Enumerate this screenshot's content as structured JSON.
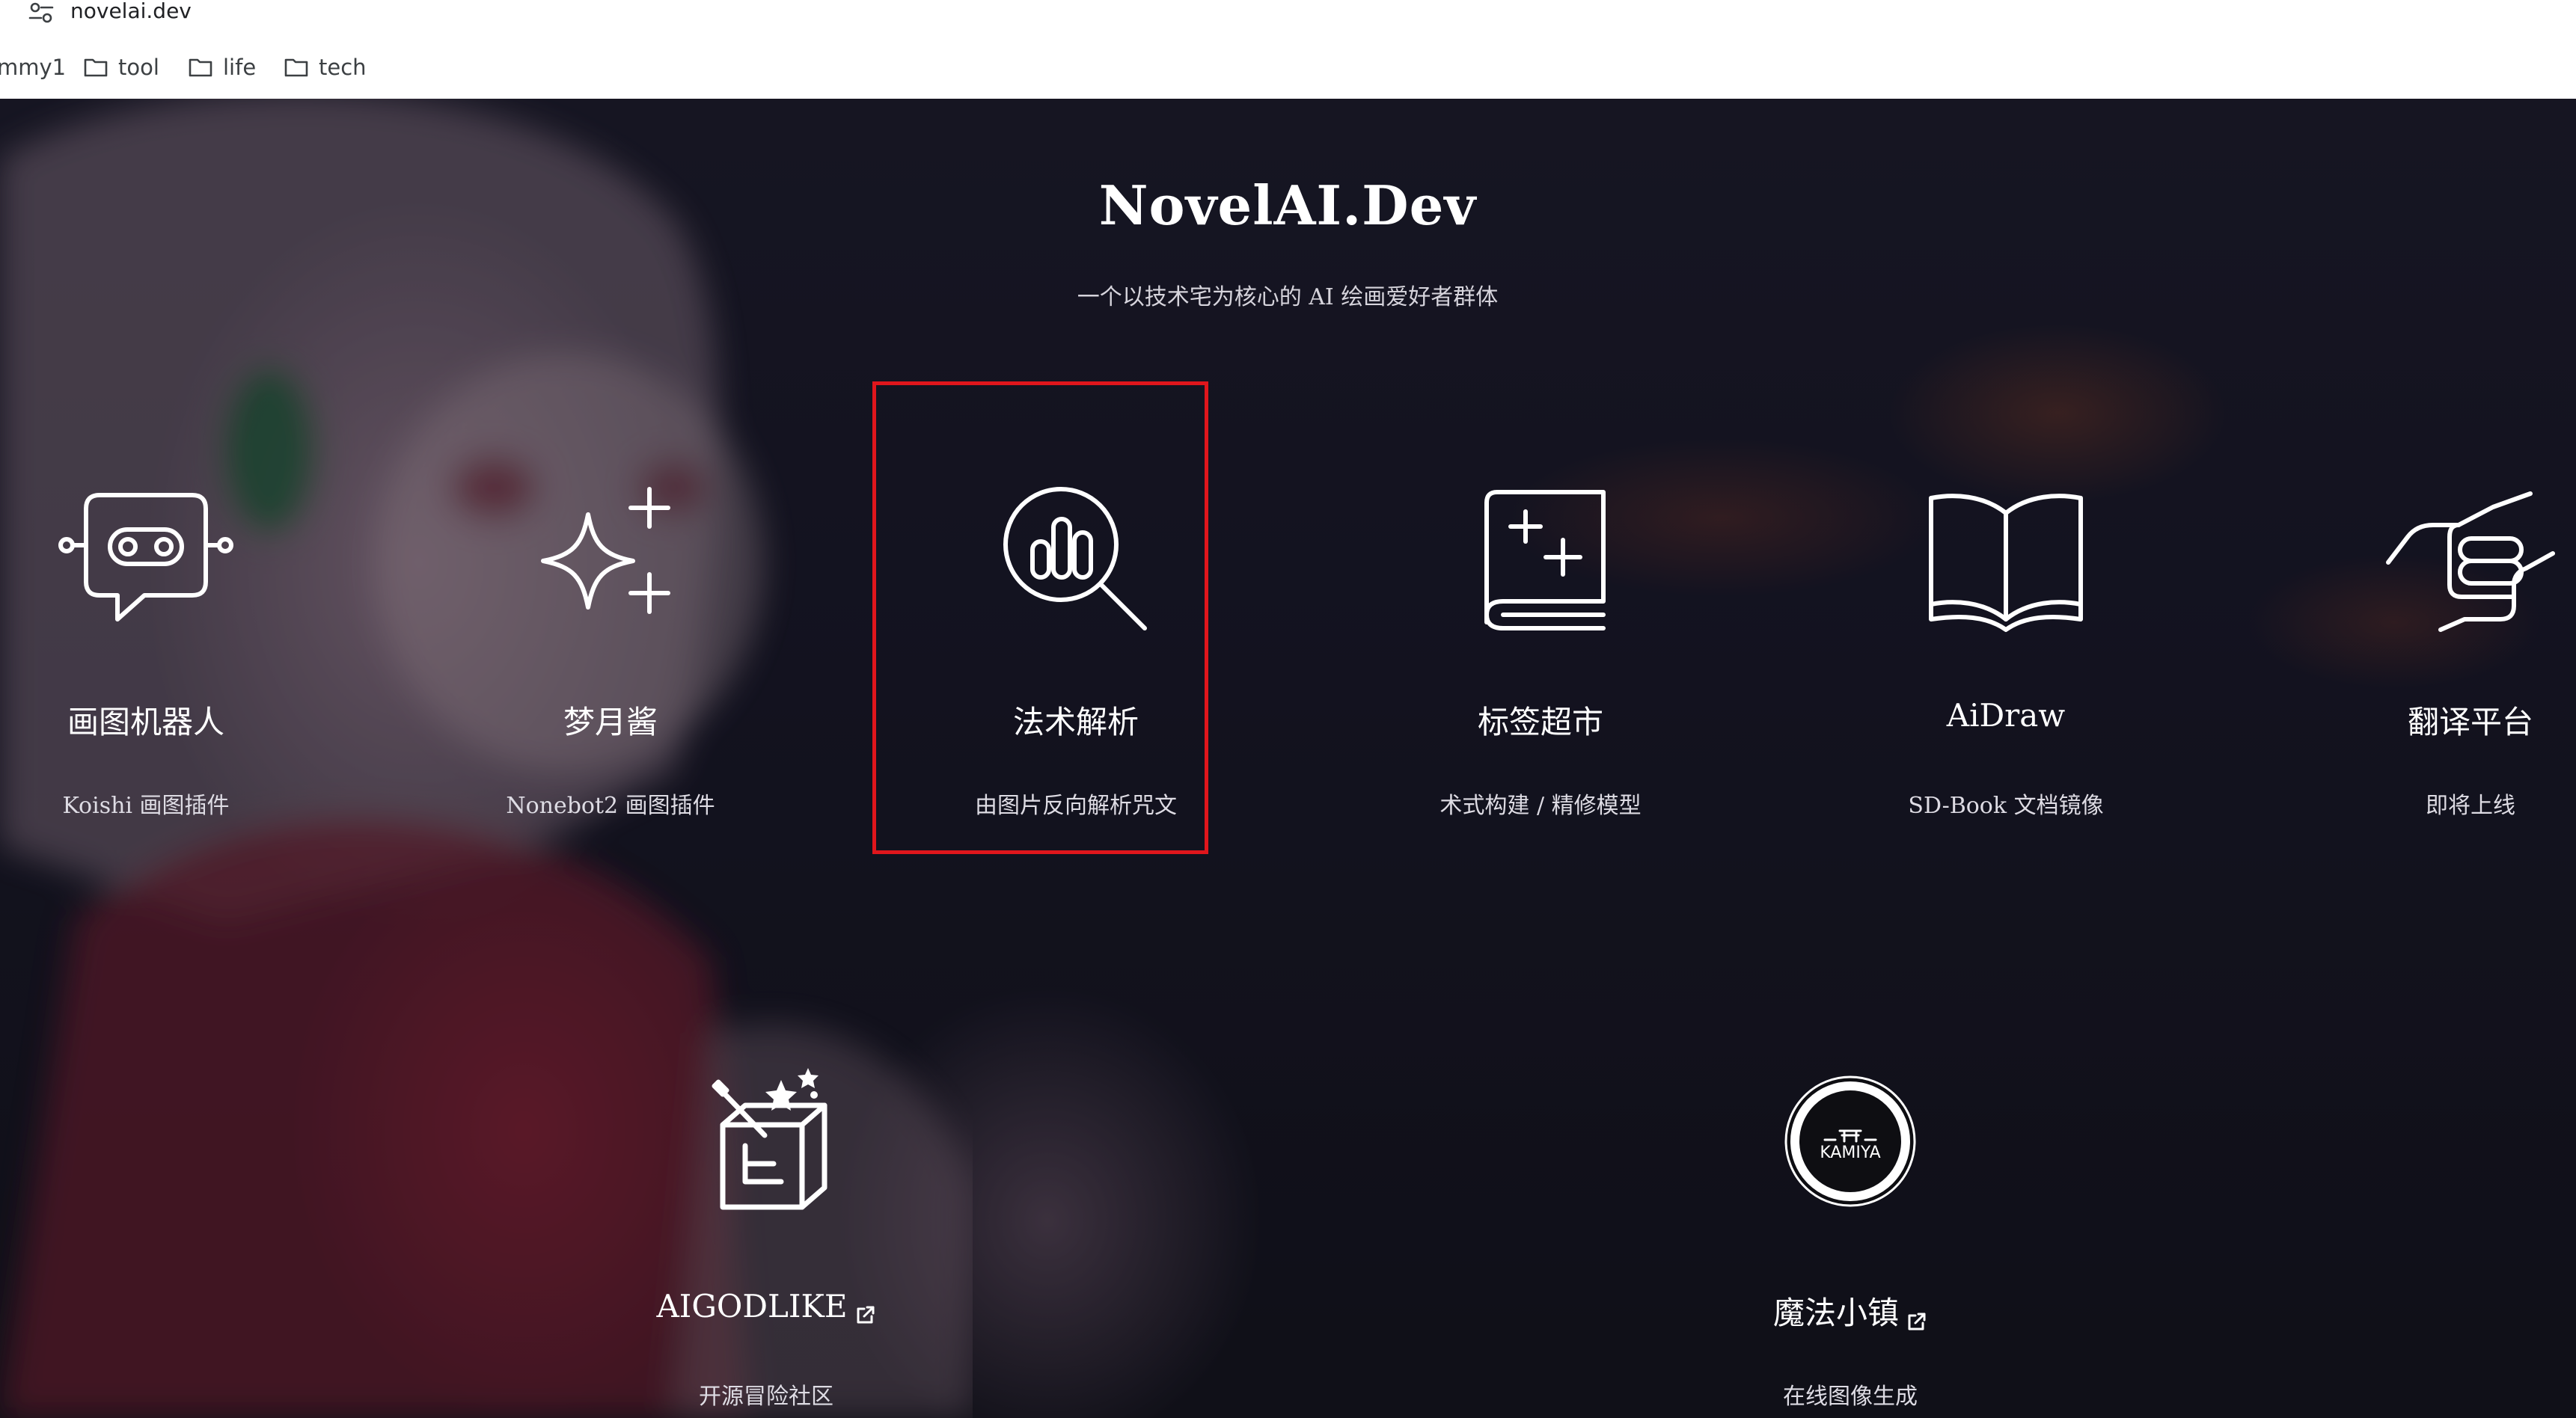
{
  "browser": {
    "url": "novelai.dev",
    "bookmarks": [
      {
        "label": "mmy1",
        "has_folder_icon": false
      },
      {
        "label": "tool",
        "has_folder_icon": true
      },
      {
        "label": "life",
        "has_folder_icon": true
      },
      {
        "label": "tech",
        "has_folder_icon": true
      }
    ]
  },
  "header": {
    "title": "NovelAI.Dev",
    "subtitle": "一个以技术宅为核心的 AI 绘画爱好者群体"
  },
  "cards": [
    {
      "label": "画图机器人",
      "desc": "Koishi 画图插件",
      "icon": "robot-chat-icon",
      "external": false
    },
    {
      "label": "梦月酱",
      "desc": "Nonebot2 画图插件",
      "icon": "sparkle-icon",
      "external": false
    },
    {
      "label": "法术解析",
      "desc": "由图片反向解析咒文",
      "icon": "chart-search-icon",
      "external": false,
      "highlighted": true
    },
    {
      "label": "标签超市",
      "desc": "术式构建 / 精修模型",
      "icon": "book-plus-icon",
      "external": false
    },
    {
      "label": "AiDraw",
      "desc": "SD-Book 文档镜像",
      "icon": "open-book-icon",
      "external": false
    },
    {
      "label": "翻译平台",
      "desc": "即将上线",
      "icon": "handshake-icon",
      "external": false
    },
    {
      "label": "AIGODLIKE",
      "desc": "开源冒险社区",
      "icon": "magic-box-icon",
      "external": true
    },
    {
      "label": "魔法小镇",
      "desc": "在线图像生成",
      "icon": "kamiya-logo-icon",
      "external": true
    }
  ],
  "logos": {
    "kamiya_text": "KAMIYA"
  },
  "colors": {
    "highlight": "#e0161c",
    "text": "#ffffff",
    "background": "#17161f"
  }
}
